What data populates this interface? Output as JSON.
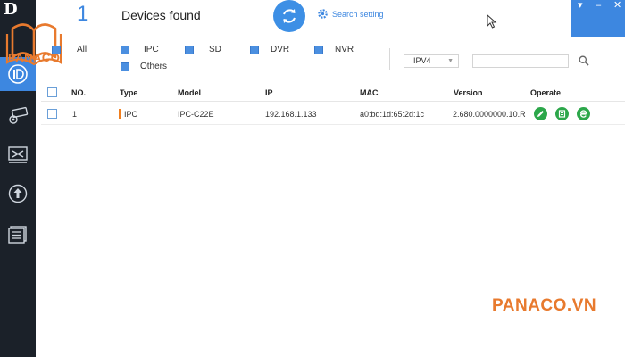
{
  "header": {
    "device_count": "1",
    "found_label": "Devices found",
    "search_setting_label": "Search setting"
  },
  "sidebar": {
    "logo": "D",
    "items": [
      {
        "icon": "dashboard-icon",
        "active": true
      },
      {
        "icon": "camera-settings-icon",
        "active": false
      },
      {
        "icon": "tools-monitor-icon",
        "active": false
      },
      {
        "icon": "upgrade-icon",
        "active": false
      },
      {
        "icon": "document-list-icon",
        "active": false
      }
    ]
  },
  "watermark": {
    "logo_text": "PANACO",
    "brand_text": "PANACO.VN"
  },
  "filters": {
    "all_label": "All",
    "options": [
      "IPC",
      "SD",
      "DVR",
      "NVR",
      "Others"
    ],
    "ip_version": "IPV4",
    "search_value": ""
  },
  "table": {
    "columns": [
      "NO.",
      "Type",
      "Model",
      "IP",
      "MAC",
      "Version",
      "Operate"
    ],
    "rows": [
      {
        "no": "1",
        "type": "IPC",
        "model": "IPC-C22E",
        "ip": "192.168.1.133",
        "mac": "a0:bd:1d:65:2d:1c",
        "version": "2.680.0000000.10.R"
      }
    ]
  },
  "colors": {
    "accent": "#3d87e0",
    "sidebar": "#1b2129",
    "operate_green": "#2ca74a",
    "brand_orange": "#e87a2e"
  }
}
